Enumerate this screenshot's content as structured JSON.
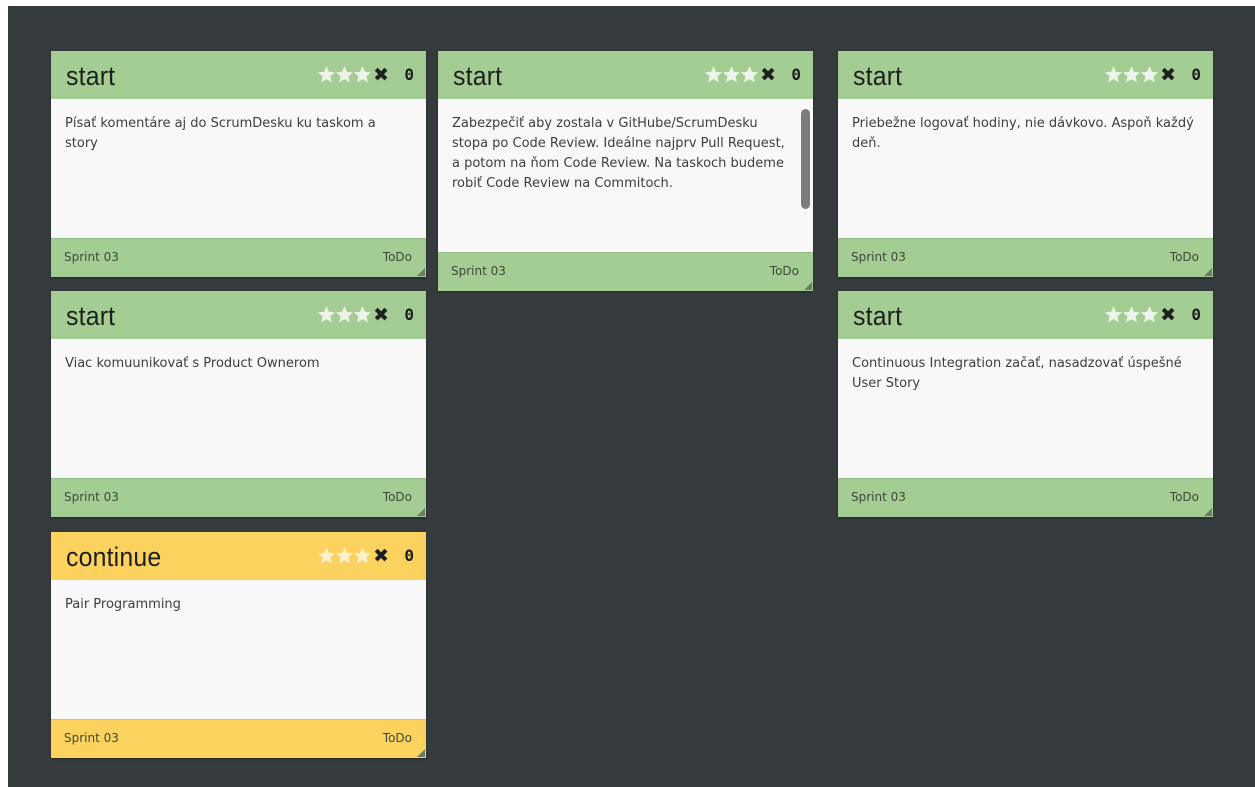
{
  "colors": {
    "board_bg": "#363b3d",
    "start": "#a4cd93",
    "continue": "#fbd25d",
    "star": "#eef3e9"
  },
  "cards": [
    {
      "title": "start",
      "votes": "0",
      "text": "Písať komentáre aj do ScrumDesku ku taskom a story",
      "sprint": "Sprint 03",
      "status": "ToDo"
    },
    {
      "title": "start",
      "votes": "0",
      "text": "Zabezpečiť aby zostala v GitHube/ScrumDesku stopa po Code Review. Ideálne najprv Pull Request, a potom na ňom Code Review. Na taskoch budeme robiť Code Review na Commitoch.",
      "sprint": "Sprint 03",
      "status": "ToDo"
    },
    {
      "title": "start",
      "votes": "0",
      "text": "Priebežne logovať hodiny, nie dávkovo. Aspoň každý deň.",
      "sprint": "Sprint 03",
      "status": "ToDo"
    },
    {
      "title": "start",
      "votes": "0",
      "text": "Viac komuunikovať s Product Ownerom",
      "sprint": "Sprint 03",
      "status": "ToDo"
    },
    {
      "title": "start",
      "votes": "0",
      "text": "Continuous Integration začať, nasadzovať úspešné User Story",
      "sprint": "Sprint 03",
      "status": "ToDo"
    },
    {
      "title": "continue",
      "votes": "0",
      "text": "Pair Programming",
      "sprint": "Sprint 03",
      "status": "ToDo"
    }
  ]
}
